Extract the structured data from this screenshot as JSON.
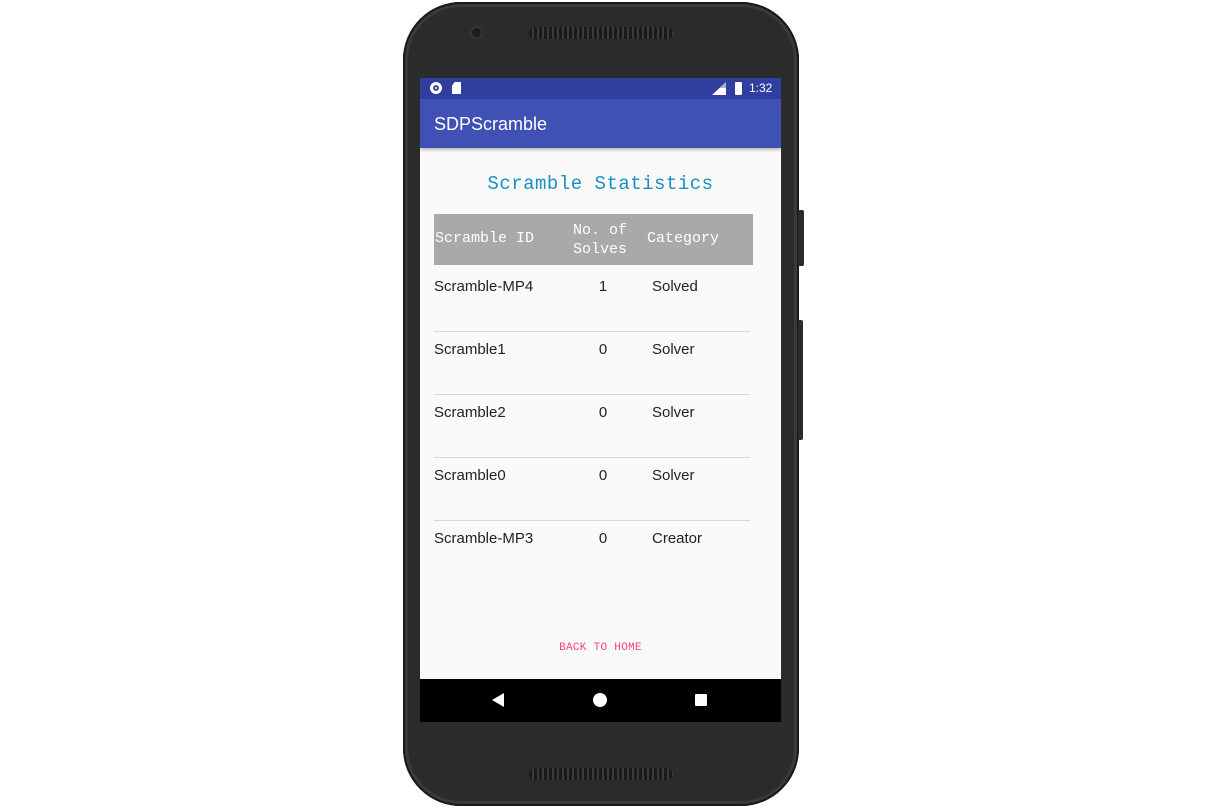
{
  "status_bar": {
    "time": "1:32",
    "icons": [
      "notification-dot-icon",
      "sd-card-icon",
      "lte-signal-icon",
      "battery-icon"
    ],
    "color": "#303f9f"
  },
  "app_bar": {
    "title": "SDPScramble",
    "color": "#3f51b5"
  },
  "page": {
    "title": "Scramble Statistics",
    "title_color": "#1a8fc4"
  },
  "table": {
    "header_color": "#a9a9a9",
    "columns": {
      "id": "Scramble ID",
      "solves_line1": "No. of",
      "solves_line2": "Solves",
      "category": "Category"
    },
    "rows": [
      {
        "id": "Scramble-MP4",
        "solves": "1",
        "category": "Solved"
      },
      {
        "id": "Scramble1",
        "solves": "0",
        "category": "Solver"
      },
      {
        "id": "Scramble2",
        "solves": "0",
        "category": "Solver"
      },
      {
        "id": "Scramble0",
        "solves": "0",
        "category": "Solver"
      },
      {
        "id": "Scramble-MP3",
        "solves": "0",
        "category": "Creator"
      }
    ]
  },
  "actions": {
    "back_to_home": "BACK TO HOME",
    "accent_color": "#ff4081"
  },
  "nav_bar": {
    "icons": [
      "back-triangle-icon",
      "home-circle-icon",
      "recents-square-icon"
    ]
  }
}
